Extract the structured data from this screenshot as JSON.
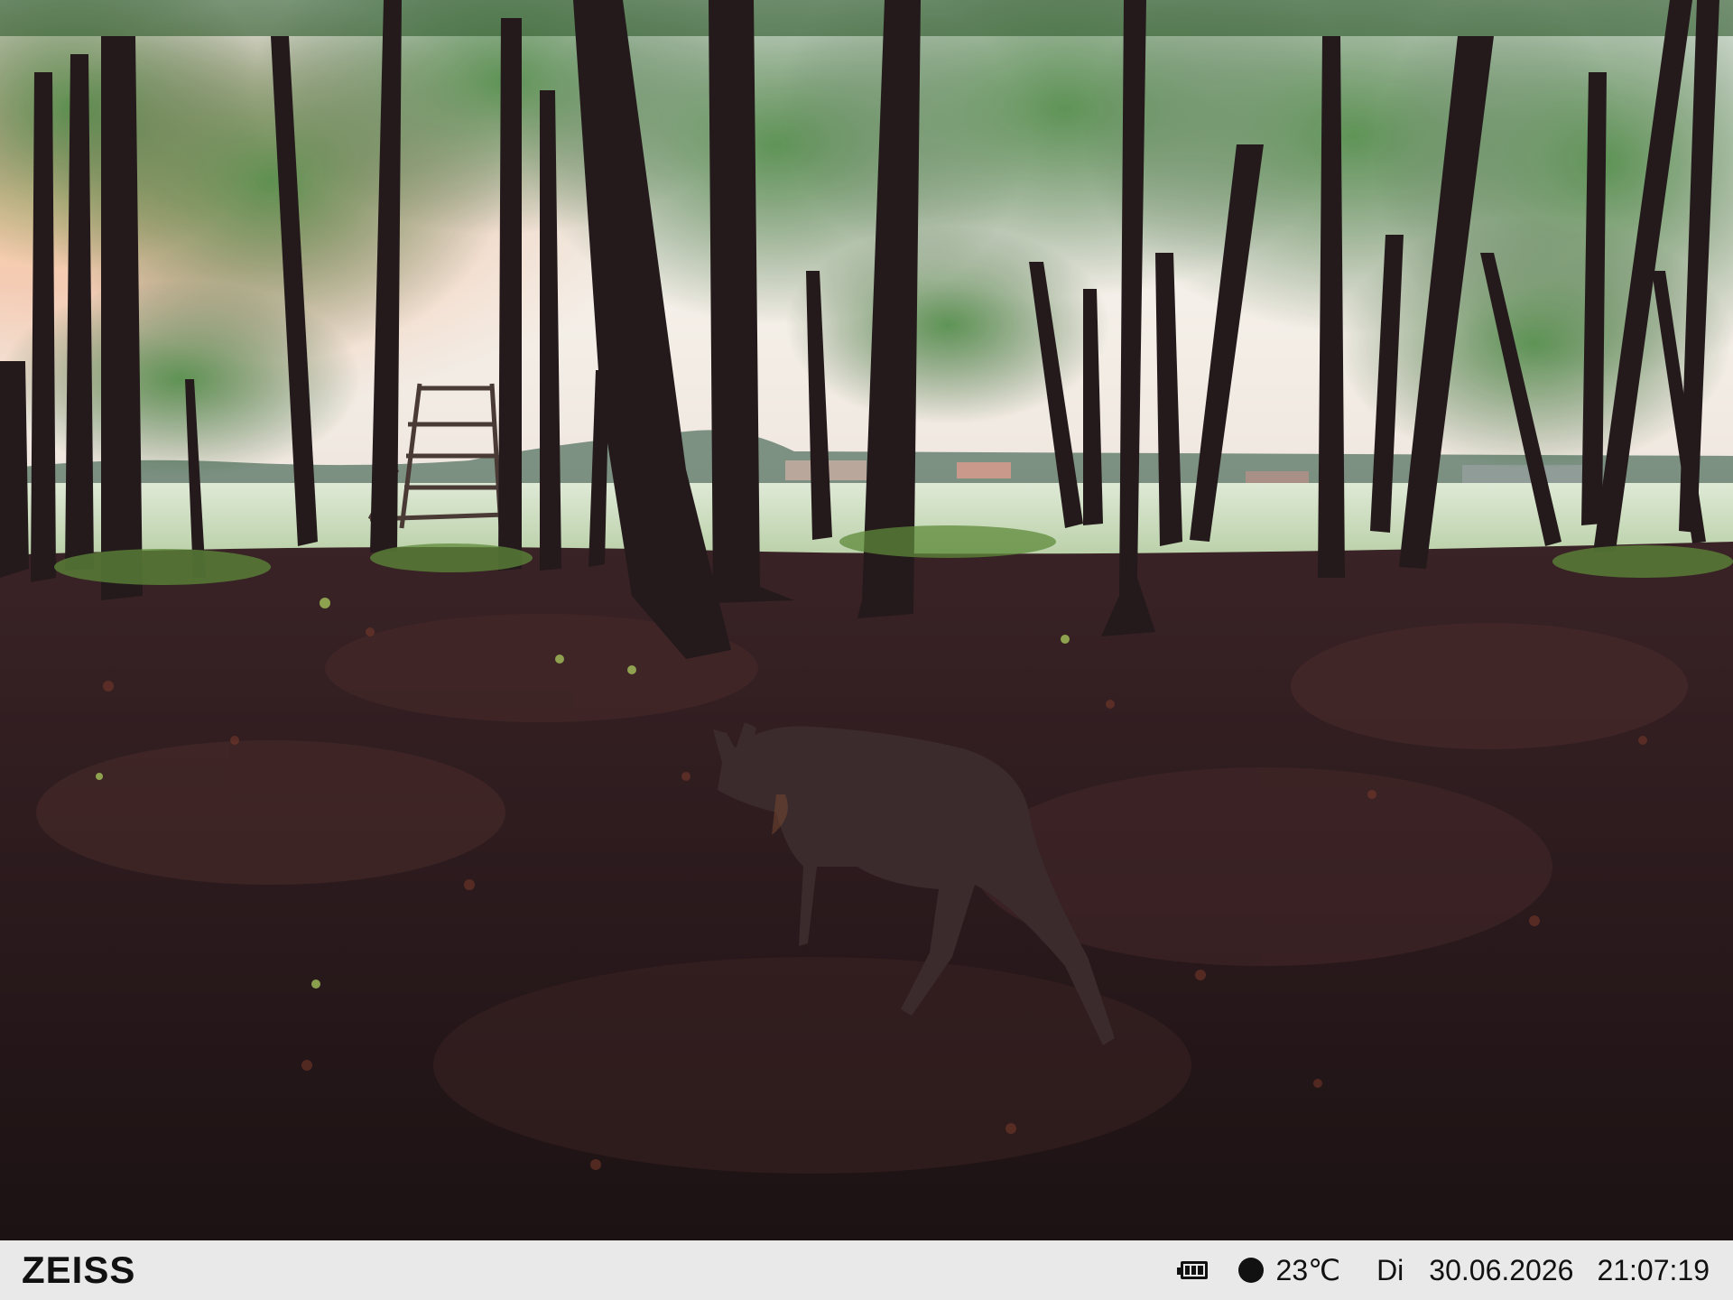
{
  "camera": {
    "brand": "ZEISS",
    "battery_icon": "battery-icon",
    "moon_phase_icon": "moon-phase-icon",
    "temperature": "23℃",
    "weekday": "Di",
    "date": "30.06.2026",
    "time": "21:07:19"
  },
  "colors": {
    "info_bar_bg": "#e9e9e9",
    "info_bar_text": "#111111",
    "forest_floor": "#2a1a1a",
    "sky": "#f2f0ea",
    "foliage": "#3b6b34"
  }
}
